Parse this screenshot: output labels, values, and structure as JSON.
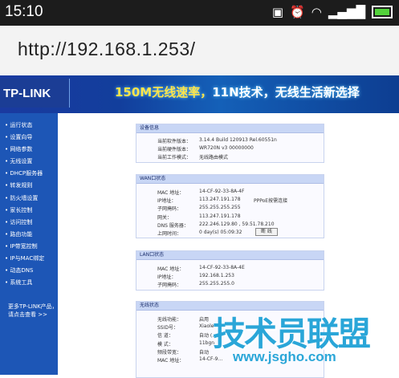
{
  "status_bar": {
    "time": "15:10",
    "icons": [
      "sim-icon",
      "alarm-icon",
      "wifi-icon",
      "signal-icon",
      "battery-icon"
    ]
  },
  "browser": {
    "url": "http://192.168.1.253/"
  },
  "banner": {
    "logo": "TP-LINK",
    "slogan_prefix": "150M无线速率，",
    "slogan_mid": "11N技术，",
    "slogan_suffix": "无线生活新选择"
  },
  "sidebar": {
    "items": [
      "运行状态",
      "设置向导",
      "网络参数",
      "无线设置",
      "DHCP服务器",
      "转发规则",
      "防火墙设置",
      "家长控制",
      "访问控制",
      "路由功能",
      "IP带宽控制",
      "IP与MAC绑定",
      "动态DNS",
      "系统工具"
    ],
    "more_line1": "更多TP-LINK产品，",
    "more_line2": "请点击查看 >>"
  },
  "device_info": {
    "title": "设备信息",
    "rows": [
      {
        "label": "当前软件版本：",
        "value": "3.14.4 Build 120913 Rel.60551n"
      },
      {
        "label": "当前硬件版本：",
        "value": "WR720N v3 00000000"
      },
      {
        "label": "当前工作模式：",
        "value": "无线路由模式"
      }
    ]
  },
  "wan": {
    "title": "WAN口状态",
    "rows": [
      {
        "label": "MAC 地址：",
        "value": "14-CF-92-33-8A-4F"
      },
      {
        "label": "IP地址：",
        "value": "113.247.191.178",
        "extra": "PPPoE按需连接"
      },
      {
        "label": "子网掩码：",
        "value": "255.255.255.255"
      },
      {
        "label": "网关：",
        "value": "113.247.191.178"
      },
      {
        "label": "DNS 服务器：",
        "value": "222.246.129.80 , 59.51.78.210"
      },
      {
        "label": "上网时间：",
        "value": "0 day(s) 05:09:32"
      }
    ],
    "disconnect_button": "断 线"
  },
  "lan": {
    "title": "LAN口状态",
    "rows": [
      {
        "label": "MAC 地址：",
        "value": "14-CF-92-33-8A-4E"
      },
      {
        "label": "IP地址：",
        "value": "192.168.1.253"
      },
      {
        "label": "子网掩码：",
        "value": "255.255.255.0"
      }
    ]
  },
  "wireless": {
    "title": "无线状态",
    "rows": [
      {
        "label": "无线功能：",
        "value": "启用"
      },
      {
        "label": "SSID号：",
        "value": "Xiaole"
      },
      {
        "label": "信 道：",
        "value": "自动 (…"
      },
      {
        "label": "模 式：",
        "value": "11bgn"
      },
      {
        "label": "频段带宽：",
        "value": "自动"
      },
      {
        "label": "MAC 地址：",
        "value": "14-CF-9…"
      }
    ]
  },
  "watermark": {
    "text": "技术员联盟",
    "url": "www.jsgho.com"
  }
}
